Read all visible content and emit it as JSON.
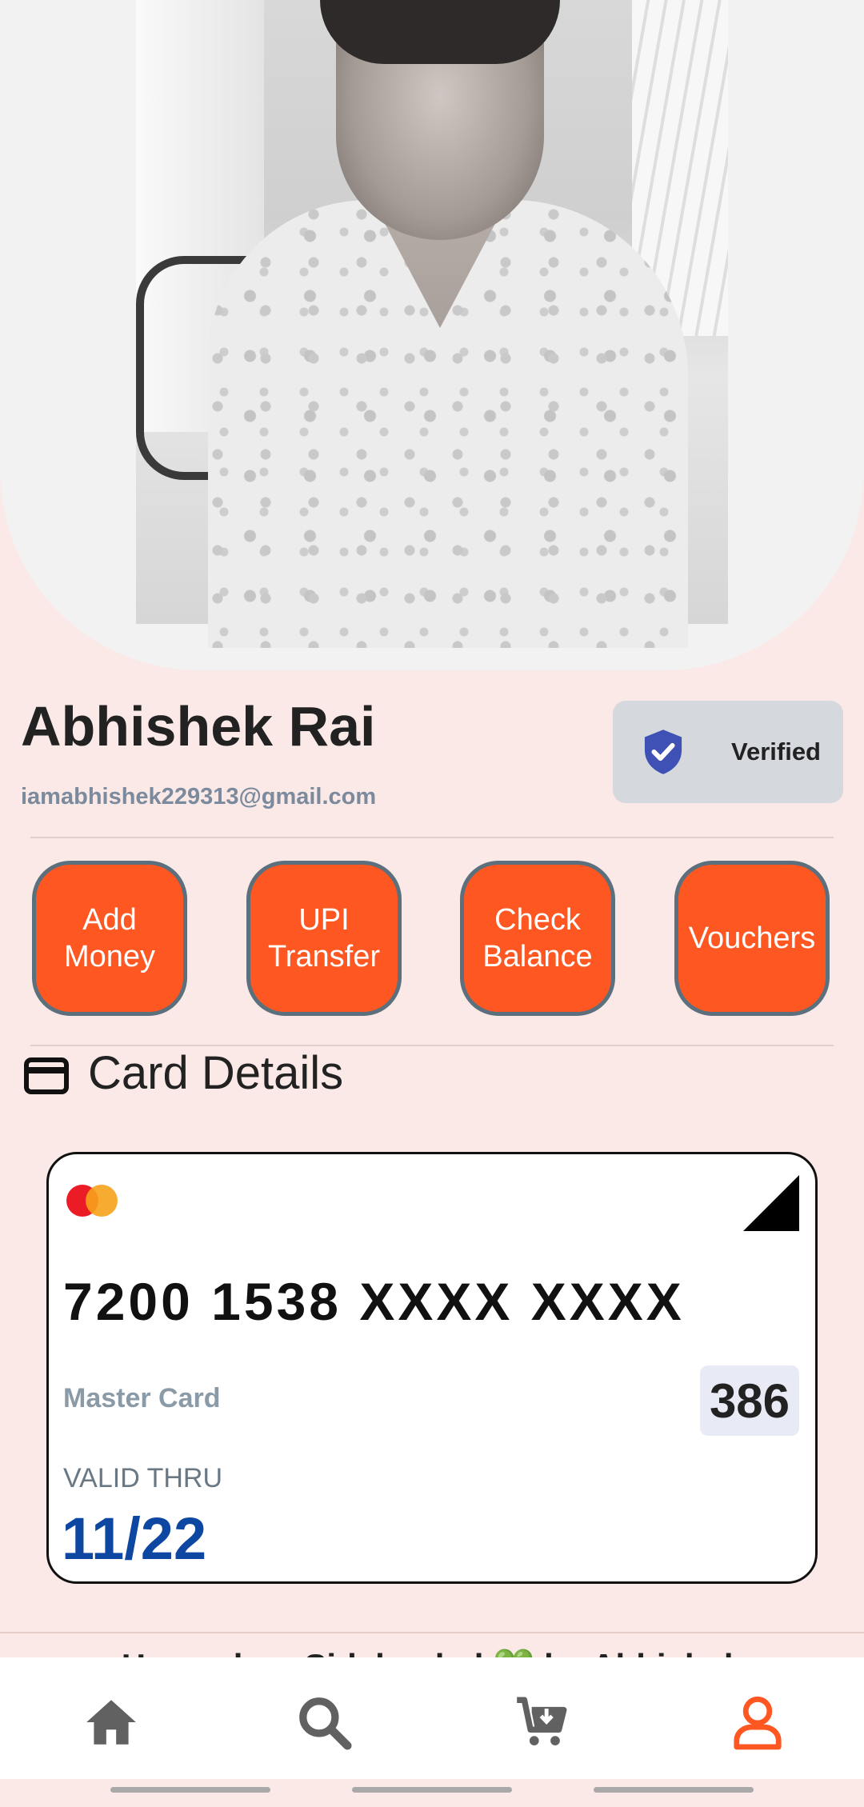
{
  "profile": {
    "name": "Abhishek Rai",
    "email": "iamabhishek229313@gmail.com",
    "verified_label": "Verified"
  },
  "actions": [
    {
      "label": "Add\nMoney"
    },
    {
      "label": "UPI\nTransfer"
    },
    {
      "label": "Check\nBalance"
    },
    {
      "label": "Vouchers"
    }
  ],
  "card_section": {
    "title": "Card Details",
    "card_number": "7200 1538 XXXX XXXX",
    "card_type": "Master Card",
    "cvv": "386",
    "valid_label": "VALID THRU",
    "valid_date": "11/22"
  },
  "footer": {
    "text": "Hampshop Sideloaded 💚 by Abhishek"
  },
  "bottom_nav": {
    "items": [
      "home-icon",
      "search-icon",
      "cart-icon",
      "profile-icon"
    ],
    "active_index": 3,
    "active_color": "#ff5722",
    "inactive_color": "#616161"
  },
  "colors": {
    "background": "#fbe9e7",
    "accent": "#ff5722",
    "verified_shield": "#3f51b5",
    "valid_date": "#0d47a1"
  }
}
